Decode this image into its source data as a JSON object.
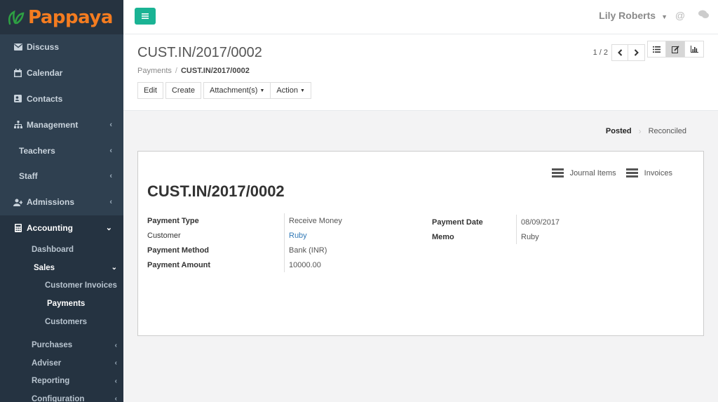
{
  "brand": {
    "name": "Pappaya"
  },
  "sidebar": {
    "items": [
      {
        "label": "Discuss",
        "icon": "envelope-icon"
      },
      {
        "label": "Calendar",
        "icon": "calendar-icon"
      },
      {
        "label": "Contacts",
        "icon": "contact-card-icon"
      },
      {
        "label": "Management",
        "icon": "sitemap-icon"
      },
      {
        "label": "Teachers"
      },
      {
        "label": "Staff"
      },
      {
        "label": "Admissions",
        "icon": "user-plus-icon"
      },
      {
        "label": "Accounting",
        "icon": "calculator-icon"
      }
    ],
    "accounting_sub": [
      {
        "label": "Dashboard"
      },
      {
        "label": "Sales"
      },
      {
        "label": "Customer Invoices"
      },
      {
        "label": "Payments"
      },
      {
        "label": "Customers"
      },
      {
        "label": "Purchases"
      },
      {
        "label": "Adviser"
      },
      {
        "label": "Reporting"
      },
      {
        "label": "Configuration"
      }
    ]
  },
  "topbar": {
    "user": "Lily Roberts"
  },
  "control_panel": {
    "title": "CUST.IN/2017/0002",
    "breadcrumb": {
      "parent": "Payments",
      "separator": "/",
      "current": "CUST.IN/2017/0002"
    },
    "buttons": {
      "edit": "Edit",
      "create": "Create",
      "attachments": "Attachment(s)",
      "action": "Action"
    },
    "pager": "1 / 2"
  },
  "status": {
    "posted": "Posted",
    "reconciled": "Reconciled"
  },
  "form": {
    "smart_buttons": {
      "journal_items": "Journal Items",
      "invoices": "Invoices"
    },
    "title": "CUST.IN/2017/0002",
    "left": {
      "payment_type_label": "Payment Type",
      "payment_type": "Receive Money",
      "customer_label": "Customer",
      "customer": "Ruby",
      "payment_method_label": "Payment Method",
      "payment_method": "Bank (INR)",
      "payment_amount_label": "Payment Amount",
      "payment_amount": "10000.00"
    },
    "right": {
      "payment_date_label": "Payment Date",
      "payment_date": "08/09/2017",
      "memo_label": "Memo",
      "memo": "Ruby"
    }
  },
  "colors": {
    "sidebar": "#2f4050",
    "accent": "#1ab394",
    "brand_orange": "#f47c20",
    "link": "#337ab7"
  }
}
